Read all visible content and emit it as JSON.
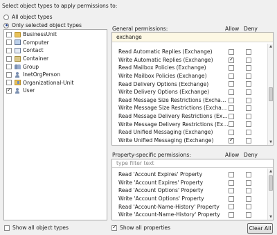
{
  "title": "Select object types to apply permissions to:",
  "scope": {
    "all_label": "All object types",
    "selected_label": "Only selected object types",
    "selected": "selected"
  },
  "object_types": [
    {
      "label": "BusinessUnit",
      "icon": "folder-icon",
      "checked": false
    },
    {
      "label": "Computer",
      "icon": "computer-icon",
      "checked": false
    },
    {
      "label": "Contact",
      "icon": "contact-icon",
      "checked": false
    },
    {
      "label": "Container",
      "icon": "container-icon",
      "checked": false
    },
    {
      "label": "Group",
      "icon": "group-icon",
      "checked": false
    },
    {
      "label": "InetOrgPerson",
      "icon": "person-icon",
      "checked": false
    },
    {
      "label": "Organizational-Unit",
      "icon": "organizational-unit-icon",
      "checked": false
    },
    {
      "label": "User",
      "icon": "user-icon",
      "checked": true
    }
  ],
  "general": {
    "header": "General permissions:",
    "allow_header": "Allow",
    "deny_header": "Deny",
    "filter_value": "exchange",
    "rows": [
      {
        "label": "Read Automatic Replies (Exchange)",
        "allow": false,
        "deny": false
      },
      {
        "label": "Write Automatic Replies (Exchange)",
        "allow": true,
        "deny": false
      },
      {
        "label": "Read Mailbox Policies (Exchange)",
        "allow": false,
        "deny": false
      },
      {
        "label": "Write Mailbox Policies (Exchange)",
        "allow": false,
        "deny": false
      },
      {
        "label": "Read Delivery Options (Exchange)",
        "allow": false,
        "deny": false
      },
      {
        "label": "Write Delivery Options (Exchange)",
        "allow": false,
        "deny": false
      },
      {
        "label": "Read Message Size Restrictions (Exchange)",
        "allow": false,
        "deny": false
      },
      {
        "label": "Write Message Size Restrictions (Exchange)",
        "allow": false,
        "deny": false
      },
      {
        "label": "Read Message Delivery Restrictions (Exchan...",
        "allow": false,
        "deny": false
      },
      {
        "label": "Write Message Delivery Restrictions (Exchan...",
        "allow": false,
        "deny": false
      },
      {
        "label": "Read Unified Messaging (Exchange)",
        "allow": false,
        "deny": false
      },
      {
        "label": "Write Unified Messaging (Exchange)",
        "allow": true,
        "deny": false
      }
    ]
  },
  "property": {
    "header": "Property-specific permissions:",
    "allow_header": "Allow",
    "deny_header": "Deny",
    "filter_placeholder": "type filter text",
    "rows": [
      {
        "label": "Read 'Account Expires' Property",
        "allow": false,
        "deny": false
      },
      {
        "label": "Write 'Account Expires' Property",
        "allow": false,
        "deny": false
      },
      {
        "label": "Read 'Account Options' Property",
        "allow": false,
        "deny": false
      },
      {
        "label": "Write 'Account Options' Property",
        "allow": false,
        "deny": false
      },
      {
        "label": "Read 'Account-Name-History' Property",
        "allow": false,
        "deny": false
      },
      {
        "label": "Write 'Account-Name-History' Property",
        "allow": false,
        "deny": false
      }
    ]
  },
  "footer": {
    "show_all_object_types": "Show all object types",
    "show_all_object_types_checked": false,
    "show_all_properties": "Show all properties",
    "show_all_properties_checked": true,
    "clear_all": "Clear All"
  }
}
